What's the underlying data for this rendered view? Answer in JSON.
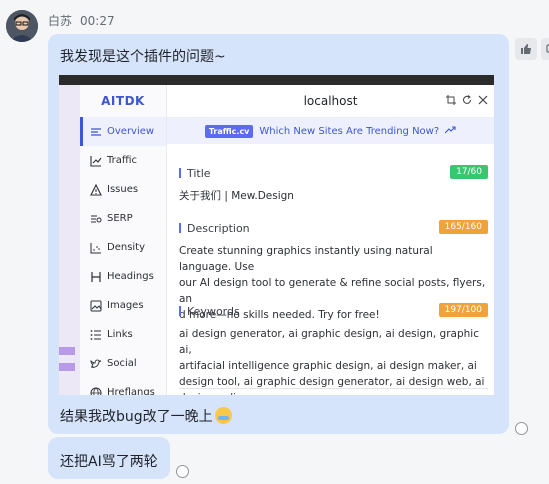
{
  "sender": {
    "name": "白苏",
    "time": "00:27"
  },
  "messages": {
    "m1_text": "我发现是这个插件的问题~",
    "m1_caption": "结果我改bug改了一晚上",
    "m2_text": "还把AI骂了两轮"
  },
  "plugin": {
    "brand": "AITDK",
    "host": "localhost",
    "promo_badge": "Traffic.cv",
    "promo_text": "Which New Sites Are Trending Now?",
    "nav": [
      {
        "label": "Overview",
        "icon": "overview-icon"
      },
      {
        "label": "Traffic",
        "icon": "traffic-icon"
      },
      {
        "label": "Issues",
        "icon": "warning-icon"
      },
      {
        "label": "SERP",
        "icon": "serp-icon"
      },
      {
        "label": "Density",
        "icon": "density-icon"
      },
      {
        "label": "Headings",
        "icon": "heading-icon"
      },
      {
        "label": "Images",
        "icon": "image-icon"
      },
      {
        "label": "Links",
        "icon": "links-icon"
      },
      {
        "label": "Social",
        "icon": "twitter-icon"
      },
      {
        "label": "Hreflangs",
        "icon": "globe-icon"
      }
    ],
    "title": {
      "label": "Title",
      "count": "17/60",
      "value": "关于我们 | Mew.Design"
    },
    "description": {
      "label": "Description",
      "count": "165/160",
      "value": "Create stunning graphics instantly using natural language. Use\nour AI design tool to generate & refine social posts, flyers, an\nd more—no skills needed. Try for free!"
    },
    "keywords": {
      "label": "Keywords",
      "count": "197/100",
      "value": "ai design generator, ai graphic design, ai design, graphic ai,\nartifacial intelligence graphic design, ai design maker, ai\ndesign tool, ai graphic design generator, ai design web, ai\ndesign online."
    }
  },
  "colors": {
    "accent": "#3d56d1",
    "bubble": "#d6e4fb",
    "ok": "#3ac66f",
    "warn": "#f0a23b"
  }
}
